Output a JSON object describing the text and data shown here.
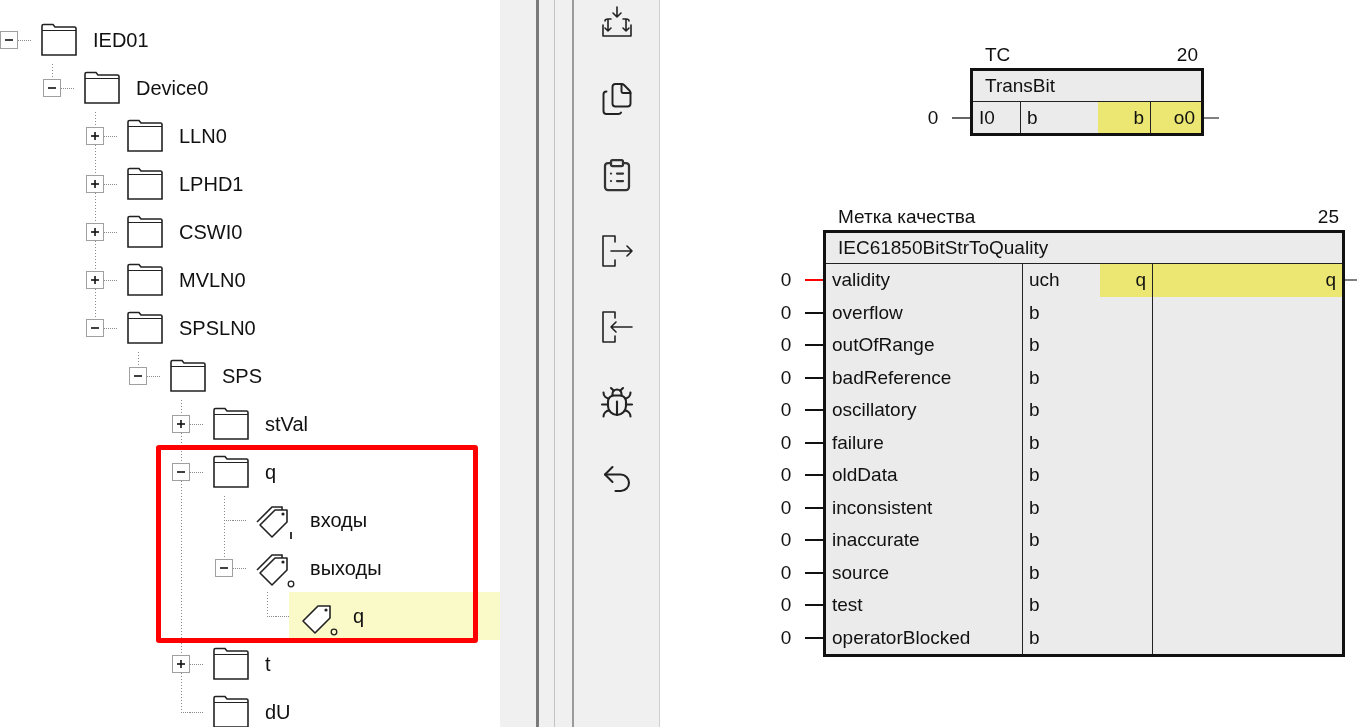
{
  "tree": [
    {
      "label": "IED01",
      "kind": "folder",
      "expanded": true,
      "selected": false,
      "children": [
        {
          "label": "Device0",
          "kind": "folder",
          "expanded": true,
          "selected": false,
          "children": [
            {
              "label": "LLN0",
              "kind": "folder",
              "expanded": false,
              "selected": false
            },
            {
              "label": "LPHD1",
              "kind": "folder",
              "expanded": false,
              "selected": false
            },
            {
              "label": "CSWI0",
              "kind": "folder",
              "expanded": false,
              "selected": false
            },
            {
              "label": "MVLN0",
              "kind": "folder",
              "expanded": false,
              "selected": false
            },
            {
              "label": "SPSLN0",
              "kind": "folder",
              "expanded": true,
              "selected": false,
              "children": [
                {
                  "label": "SPS",
                  "kind": "folder",
                  "expanded": true,
                  "selected": false,
                  "children": [
                    {
                      "label": "stVal",
                      "kind": "folder",
                      "expanded": false,
                      "selected": false
                    },
                    {
                      "label": "q",
                      "kind": "folder",
                      "expanded": true,
                      "selected": false,
                      "framed": true,
                      "children": [
                        {
                          "label": "входы",
                          "kind": "inputs",
                          "selected": false
                        },
                        {
                          "label": "выходы",
                          "kind": "outputs",
                          "expanded": true,
                          "selected": false,
                          "children": [
                            {
                              "label": "q",
                              "kind": "output",
                              "selected": true
                            }
                          ]
                        }
                      ]
                    },
                    {
                      "label": "t",
                      "kind": "folder",
                      "expanded": false,
                      "selected": false
                    },
                    {
                      "label": "dU",
                      "kind": "folder",
                      "selected": false
                    }
                  ]
                }
              ]
            }
          ]
        }
      ]
    }
  ],
  "blocks": [
    {
      "caption": "TC",
      "number": "20",
      "title": "TransBit",
      "rows": [
        {
          "value": "0",
          "color": "#666666",
          "input": "I0",
          "type": "b",
          "output_type": "b",
          "output": "o0"
        }
      ]
    },
    {
      "caption": "Метка качества",
      "number": "25",
      "title": "IEC61850BitStrToQuality",
      "rows": [
        {
          "value": "0",
          "color": "#ff0000",
          "input": "validity",
          "type": "uch",
          "output_type": "q",
          "output": "q"
        },
        {
          "value": "0",
          "color": "#111111",
          "input": "overflow",
          "type": "b"
        },
        {
          "value": "0",
          "color": "#111111",
          "input": "outOfRange",
          "type": "b"
        },
        {
          "value": "0",
          "color": "#111111",
          "input": "badReference",
          "type": "b"
        },
        {
          "value": "0",
          "color": "#111111",
          "input": "oscillatory",
          "type": "b"
        },
        {
          "value": "0",
          "color": "#111111",
          "input": "failure",
          "type": "b"
        },
        {
          "value": "0",
          "color": "#111111",
          "input": "oldData",
          "type": "b"
        },
        {
          "value": "0",
          "color": "#111111",
          "input": "inconsistent",
          "type": "b"
        },
        {
          "value": "0",
          "color": "#111111",
          "input": "inaccurate",
          "type": "b"
        },
        {
          "value": "0",
          "color": "#111111",
          "input": "source",
          "type": "b"
        },
        {
          "value": "0",
          "color": "#111111",
          "input": "test",
          "type": "b"
        },
        {
          "value": "0",
          "color": "#111111",
          "input": "operatorBlocked",
          "type": "b"
        }
      ]
    }
  ]
}
